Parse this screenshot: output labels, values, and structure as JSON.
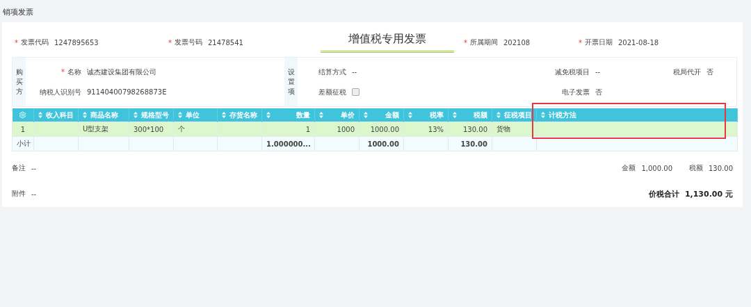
{
  "page_title": "销项发票",
  "header_fields": [
    {
      "kind": "field",
      "mark": "*",
      "label": "发票代码",
      "value": "1247895653"
    },
    {
      "kind": "field",
      "mark": "*",
      "label": "发票号码",
      "value": "21478541"
    },
    {
      "kind": "title",
      "value": "增值税专用发票"
    },
    {
      "kind": "field",
      "mark": "*",
      "label": "所属期间",
      "value": "202108"
    },
    {
      "kind": "field",
      "mark": "*",
      "label": "开票日期",
      "value": "2021-08-18"
    }
  ],
  "buyer": {
    "side_label": "购买方",
    "fields": [
      {
        "mark": "*",
        "label": "名称",
        "value": "诚杰建设集团有限公司"
      },
      {
        "label": "纳税人识别号",
        "value": "91140400798268873E"
      }
    ]
  },
  "settings": {
    "side_label": "设置项",
    "fields": [
      {
        "kind": "text",
        "label": "结算方式",
        "value": "--"
      },
      {
        "kind": "text",
        "label": "减免税项目",
        "value": "--"
      },
      {
        "kind": "text",
        "label": "税局代开",
        "value": "否"
      },
      {
        "kind": "checkbox",
        "label": "差额征税",
        "checked": false
      },
      {
        "kind": "text",
        "label": "电子发票",
        "value": "否"
      }
    ]
  },
  "table": {
    "columns": [
      {
        "kind": "gear"
      },
      {
        "kind": "text",
        "label": "收入科目"
      },
      {
        "kind": "text",
        "label": "商品名称"
      },
      {
        "kind": "text",
        "label": "规格型号"
      },
      {
        "kind": "text",
        "label": "单位"
      },
      {
        "kind": "text",
        "label": "存货名称"
      },
      {
        "kind": "number",
        "label": "数量"
      },
      {
        "kind": "number",
        "label": "单价"
      },
      {
        "kind": "number",
        "label": "金额"
      },
      {
        "kind": "number",
        "label": "税率"
      },
      {
        "kind": "number",
        "label": "税额"
      },
      {
        "kind": "text",
        "label": "征税项目"
      },
      {
        "kind": "text",
        "label": "计税方法"
      }
    ],
    "rows": [
      {
        "kind": "item",
        "highlighted": true,
        "cells": [
          "1",
          "",
          "U型支架",
          "300*100",
          "个",
          "",
          "1",
          "1000",
          "1000.00",
          "13%",
          "130.00",
          "货物",
          ""
        ]
      },
      {
        "kind": "subtotal",
        "highlighted": false,
        "cells": [
          "小计",
          "",
          "",
          "",
          "",
          "",
          "1.000000...",
          "",
          "1000.00",
          "",
          "130.00",
          "",
          ""
        ]
      }
    ]
  },
  "footer": {
    "remark": {
      "label": "备注",
      "value": "--"
    },
    "amount": {
      "label": "金额",
      "value": "1,000.00"
    },
    "tax": {
      "label": "税额",
      "value": "130.00"
    },
    "attachment": {
      "label": "附件",
      "value": "--"
    },
    "total": {
      "label": "价税合计",
      "value": "1,130.00 元"
    }
  }
}
